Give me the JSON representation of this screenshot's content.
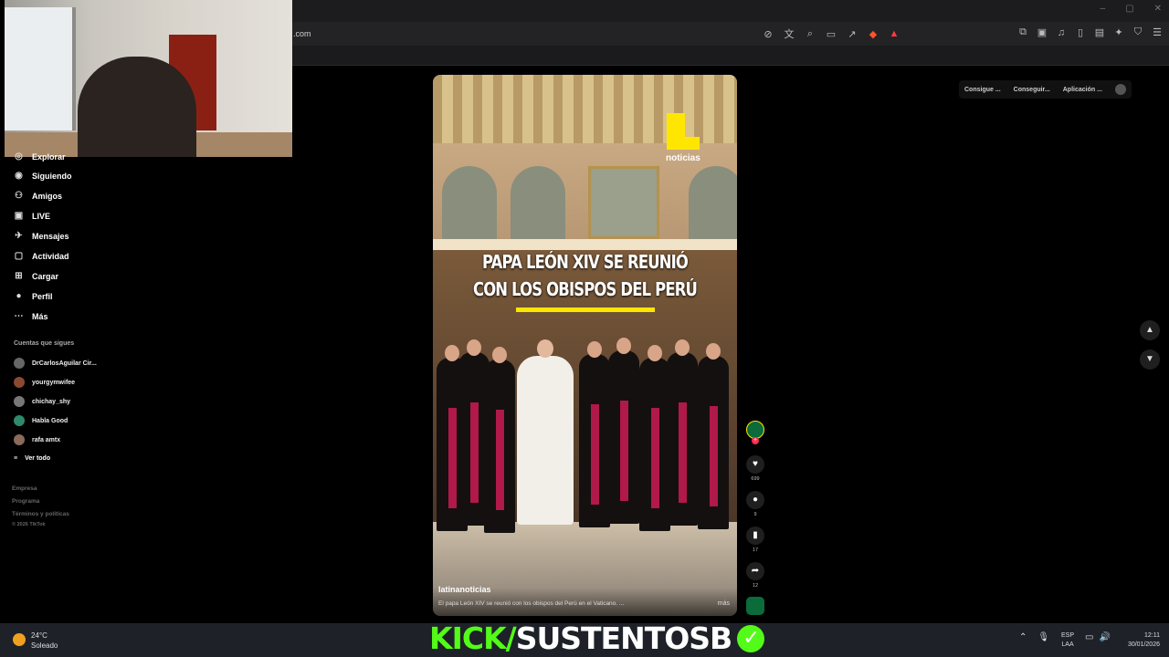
{
  "browser": {
    "url": ".com",
    "window_controls": [
      "–",
      "▢",
      "✕"
    ],
    "toolbar_icons": [
      "no-cast",
      "translate",
      "zoom",
      "cast",
      "share",
      "brave-shield",
      "rewards"
    ],
    "right_icons": [
      "extensions",
      "screenshot",
      "music",
      "sidebar",
      "wallet",
      "leo",
      "vpn",
      "menu"
    ]
  },
  "top_actions": {
    "consigue": "Consigue ...",
    "conseguir": "Conseguir...",
    "aplicacion": "Aplicación ..."
  },
  "sidebar": {
    "items": [
      {
        "label": "Explorar",
        "icon": "compass-icon"
      },
      {
        "label": "Siguiendo",
        "icon": "following-icon"
      },
      {
        "label": "Amigos",
        "icon": "friends-icon"
      },
      {
        "label": "LIVE",
        "icon": "live-icon"
      },
      {
        "label": "Mensajes",
        "icon": "messages-icon"
      },
      {
        "label": "Actividad",
        "icon": "activity-icon"
      },
      {
        "label": "Cargar",
        "icon": "upload-icon"
      },
      {
        "label": "Perfil",
        "icon": "profile-icon"
      },
      {
        "label": "Más",
        "icon": "more-icon"
      }
    ],
    "following_title": "Cuentas que sigues",
    "following": [
      {
        "name": "DrCarlosAguilar Cir...",
        "color": "#666666"
      },
      {
        "name": "yourgymwifee",
        "color": "#8a4a30"
      },
      {
        "name": "chichay_shy",
        "color": "#777777"
      },
      {
        "name": "Habla Good",
        "color": "#2e8a6a"
      },
      {
        "name": "rafa amtx",
        "color": "#8a6a5a"
      }
    ],
    "see_all": "Ver todo",
    "footer": [
      "Empresa",
      "Programa",
      "Términos y políticas",
      "© 2026 TikTok"
    ]
  },
  "video": {
    "logo_text": "noticias",
    "headline_line1": "PAPA LEÓN XIV SE REUNIÓ",
    "headline_line2": "CON LOS OBISPOS DEL PERÚ",
    "username": "latinanoticias",
    "caption": "El papa León XIV se reunió con los obispos del Perú en el Vaticano. ...",
    "more": "más"
  },
  "actions": {
    "likes": "699",
    "comments": "9",
    "saves": "17",
    "shares": "12"
  },
  "taskbar": {
    "temperature": "24°C",
    "weather": "Soleado",
    "overlay_kick": "KICK/",
    "overlay_channel": "SUSTENTOSB",
    "lang1": "ESP",
    "lang2": "LAA",
    "time": "12:11",
    "date": "30/01/2026"
  },
  "colors": {
    "kick_green": "#53fc18",
    "brand_yellow": "#ffe600",
    "tiktok_red": "#fe2c55"
  }
}
